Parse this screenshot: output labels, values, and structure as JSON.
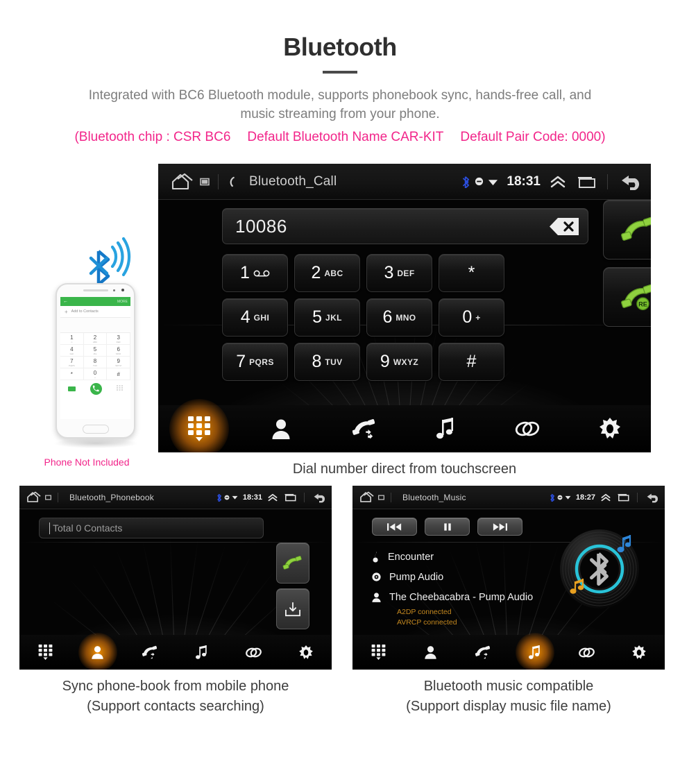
{
  "header": {
    "title": "Bluetooth",
    "subtitle_line1": "Integrated with BC6 Bluetooth module, supports phonebook sync, hands-free call, and",
    "subtitle_line2": "music streaming from your phone.",
    "spec_chip": "(Bluetooth chip : CSR BC6",
    "spec_name": "Default Bluetooth Name CAR-KIT",
    "spec_pair": "Default Pair Code: 0000)",
    "accent_pink": "#f2258a",
    "title_color": "#2f2f2f",
    "subtitle_color": "#7d7d7d"
  },
  "phone_illustration": {
    "caption": "Phone Not Included",
    "screen": {
      "app_bar_back": "←",
      "app_bar_more": "MORE",
      "add_contacts": "Add to Contacts",
      "keys": [
        {
          "digit": "1",
          "letters": "∞"
        },
        {
          "digit": "2",
          "letters": "ABC"
        },
        {
          "digit": "3",
          "letters": "DEF"
        },
        {
          "digit": "4",
          "letters": "GHI"
        },
        {
          "digit": "5",
          "letters": "JKL"
        },
        {
          "digit": "6",
          "letters": "MNO"
        },
        {
          "digit": "7",
          "letters": "PQRS"
        },
        {
          "digit": "8",
          "letters": "TUV"
        },
        {
          "digit": "9",
          "letters": "WXYZ"
        },
        {
          "digit": "*",
          "letters": ""
        },
        {
          "digit": "0",
          "letters": "+"
        },
        {
          "digit": "#",
          "letters": ""
        }
      ]
    }
  },
  "main_unit": {
    "statusbar": {
      "title": "Bluetooth_Call",
      "time": "18:31",
      "icons": [
        "home-icon",
        "sd-card-icon",
        "phone-handset-icon",
        "bluetooth-icon",
        "mute-icon",
        "wifi-icon",
        "chevron-up-icon",
        "recents-icon",
        "back-icon"
      ],
      "bluetooth_color": "#2b4ddb"
    },
    "dialer": {
      "number": "10086",
      "backspace_label": "×",
      "keys": [
        {
          "digit": "1",
          "letters": "",
          "voicemail": true
        },
        {
          "digit": "2",
          "letters": "ABC"
        },
        {
          "digit": "3",
          "letters": "DEF"
        },
        {
          "digit": "*",
          "letters": ""
        },
        {
          "digit": "4",
          "letters": "GHI"
        },
        {
          "digit": "5",
          "letters": "JKL"
        },
        {
          "digit": "6",
          "letters": "MNO"
        },
        {
          "digit": "0",
          "letters": "+"
        },
        {
          "digit": "7",
          "letters": "PQRS"
        },
        {
          "digit": "8",
          "letters": "TUV"
        },
        {
          "digit": "9",
          "letters": "WXYZ"
        },
        {
          "digit": "#",
          "letters": ""
        }
      ],
      "call_button": "call-icon",
      "redial_button": "redial-icon",
      "redial_badge": "RE",
      "green": "#8fd13f"
    },
    "nav": [
      {
        "name": "keypad",
        "icon": "keypad-icon",
        "active": true
      },
      {
        "name": "contacts",
        "icon": "contact-icon",
        "active": false
      },
      {
        "name": "call-log",
        "icon": "call-log-icon",
        "active": false
      },
      {
        "name": "music",
        "icon": "music-note-icon",
        "active": false
      },
      {
        "name": "link",
        "icon": "link-icon",
        "active": false
      },
      {
        "name": "settings",
        "icon": "gear-icon",
        "active": false
      }
    ],
    "caption": "Dial number direct from touchscreen",
    "active_highlight": "#ff9800"
  },
  "panel_phonebook": {
    "statusbar": {
      "title": "Bluetooth_Phonebook",
      "time": "18:31"
    },
    "search_value": "Total 0 Contacts",
    "buttons": [
      {
        "name": "call-button",
        "icon": "call-icon"
      },
      {
        "name": "download-contacts-button",
        "icon": "download-tray-icon"
      }
    ],
    "nav": [
      {
        "name": "keypad",
        "icon": "keypad-icon",
        "active": false
      },
      {
        "name": "contacts",
        "icon": "contact-icon",
        "active": true
      },
      {
        "name": "call-log",
        "icon": "call-log-icon",
        "active": false
      },
      {
        "name": "music",
        "icon": "music-note-icon",
        "active": false
      },
      {
        "name": "link",
        "icon": "link-icon",
        "active": false
      },
      {
        "name": "settings",
        "icon": "gear-icon",
        "active": false
      }
    ],
    "caption_line1": "Sync phone-book from mobile phone",
    "caption_line2": "(Support contacts searching)"
  },
  "panel_music": {
    "statusbar": {
      "title": "Bluetooth_Music",
      "time": "18:27"
    },
    "transport": [
      {
        "name": "previous-button",
        "icon": "skip-back-icon"
      },
      {
        "name": "pause-button",
        "icon": "pause-icon"
      },
      {
        "name": "next-button",
        "icon": "skip-forward-icon"
      }
    ],
    "track": {
      "title": "Encounter",
      "album": "Pump Audio",
      "artist": "The Cheebacabra - Pump Audio",
      "status_a2dp": "A2DP connected",
      "status_avrcp": "AVRCP connected",
      "status_color": "#c4881f"
    },
    "disc": {
      "icon": "bluetooth-disc-icon",
      "ring_color": "#29c3d8"
    },
    "nav": [
      {
        "name": "keypad",
        "icon": "keypad-icon",
        "active": false
      },
      {
        "name": "contacts",
        "icon": "contact-icon",
        "active": false
      },
      {
        "name": "call-log",
        "icon": "call-log-icon",
        "active": false
      },
      {
        "name": "music",
        "icon": "music-note-icon",
        "active": true
      },
      {
        "name": "link",
        "icon": "link-icon",
        "active": false
      },
      {
        "name": "settings",
        "icon": "gear-icon",
        "active": false
      }
    ],
    "caption_line1": "Bluetooth music compatible",
    "caption_line2": "(Support display music file name)"
  }
}
